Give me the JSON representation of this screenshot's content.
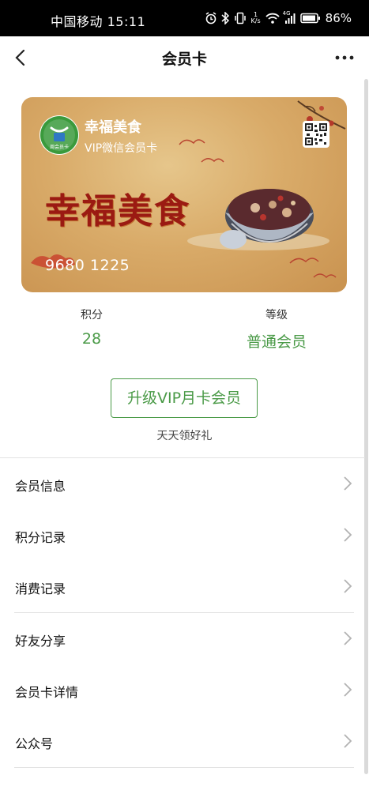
{
  "status_bar": {
    "carrier_time": "中国移动 15:11",
    "net_speed_top": "1",
    "net_speed_unit": "K/s",
    "signal_label": "4G",
    "battery": "86%",
    "icons": [
      "alarm-icon",
      "bluetooth-icon",
      "vibrate-icon",
      "wifi-icon",
      "signal-icon",
      "battery-icon"
    ]
  },
  "nav": {
    "title": "会员卡",
    "back_icon": "back-icon",
    "more_icon": "more-icon"
  },
  "card": {
    "brand": "幸福美食",
    "type": "VIP微信会员卡",
    "headline": "幸福美食",
    "number": "9680 1225",
    "logo_text": "周会员卡",
    "colors": {
      "background": "#d9ab69",
      "headline": "#9b1a12"
    }
  },
  "stats": {
    "points_label": "积分",
    "points_value": "28",
    "level_label": "等级",
    "level_value": "普通会员",
    "accent": "#4a9a47"
  },
  "upgrade": {
    "button_label": "升级VIP月卡会员",
    "subtitle": "天天领好礼"
  },
  "menu": [
    {
      "label": "会员信息"
    },
    {
      "label": "积分记录"
    },
    {
      "label": "消费记录"
    },
    {
      "label": "好友分享"
    },
    {
      "label": "会员卡详情"
    },
    {
      "label": "公众号"
    }
  ]
}
